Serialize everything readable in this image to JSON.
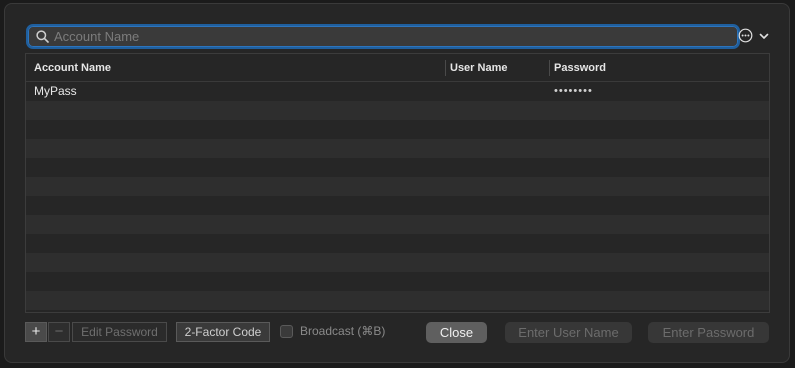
{
  "search": {
    "placeholder": "Account Name",
    "value": ""
  },
  "toolbar_icons": {
    "more": "ellipsis-circle-icon",
    "disclosure": "chevron-down-icon"
  },
  "table": {
    "columns": [
      "Account Name",
      "User Name",
      "Password"
    ],
    "rows": [
      {
        "account": "MyPass",
        "user": "",
        "password": "••••••••"
      }
    ]
  },
  "bottom": {
    "add": "+",
    "remove": "−",
    "edit_password": "Edit Password",
    "two_factor": "2-Factor Code",
    "broadcast": "Broadcast (⌘B)",
    "close": "Close",
    "enter_user": "Enter User Name",
    "enter_password": "Enter Password"
  },
  "colors": {
    "accent": "#2c74bd",
    "panel": "#262626",
    "row_alt": "#2e2e2e"
  }
}
